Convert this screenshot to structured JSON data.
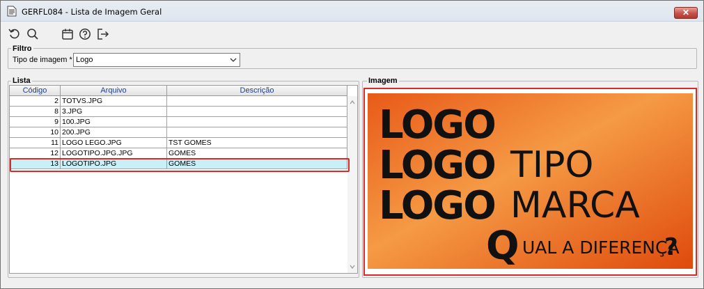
{
  "window": {
    "title": "GERFL084 - Lista de Imagem Geral",
    "close_label": "✕"
  },
  "toolbar": {
    "icons": [
      "refresh-icon",
      "search-icon",
      "calendar-icon",
      "help-icon",
      "exit-icon"
    ]
  },
  "filter": {
    "group_label": "Filtro",
    "type_label": "Tipo de imagem *",
    "type_value": "Logo"
  },
  "list": {
    "group_label": "Lista",
    "columns": [
      "Código",
      "Arquivo",
      "Descrição"
    ],
    "rows": [
      {
        "codigo": "2",
        "arquivo": "TOTVS.JPG",
        "descricao": ""
      },
      {
        "codigo": "8",
        "arquivo": "3.JPG",
        "descricao": ""
      },
      {
        "codigo": "9",
        "arquivo": "100.JPG",
        "descricao": ""
      },
      {
        "codigo": "10",
        "arquivo": "200.JPG",
        "descricao": ""
      },
      {
        "codigo": "11",
        "arquivo": "LOGO LEGO.JPG",
        "descricao": "TST GOMES"
      },
      {
        "codigo": "12",
        "arquivo": "LOGOTIPO.JPG.JPG",
        "descricao": "GOMES"
      },
      {
        "codigo": "13",
        "arquivo": "LOGOTIPO.JPG",
        "descricao": "GOMES"
      }
    ],
    "selected_index": 6
  },
  "image": {
    "group_label": "Imagem",
    "art": {
      "line1": "LOGO",
      "line2_bold": "LOGO",
      "line2_light": "TIPO",
      "line3_bold": "LOGO",
      "line3_light": "MARCA",
      "line4_bold": "Q",
      "line4_light": "UAL A DIFERENÇA",
      "line4_mark": "?"
    },
    "colors": {
      "bg_light": "#f59a45",
      "bg_dark": "#e24f10",
      "ink": "#111111"
    }
  },
  "colors": {
    "accent_red": "#d92a2a",
    "header_text": "#1c3f8a",
    "selected_row": "#c8f0f8"
  }
}
